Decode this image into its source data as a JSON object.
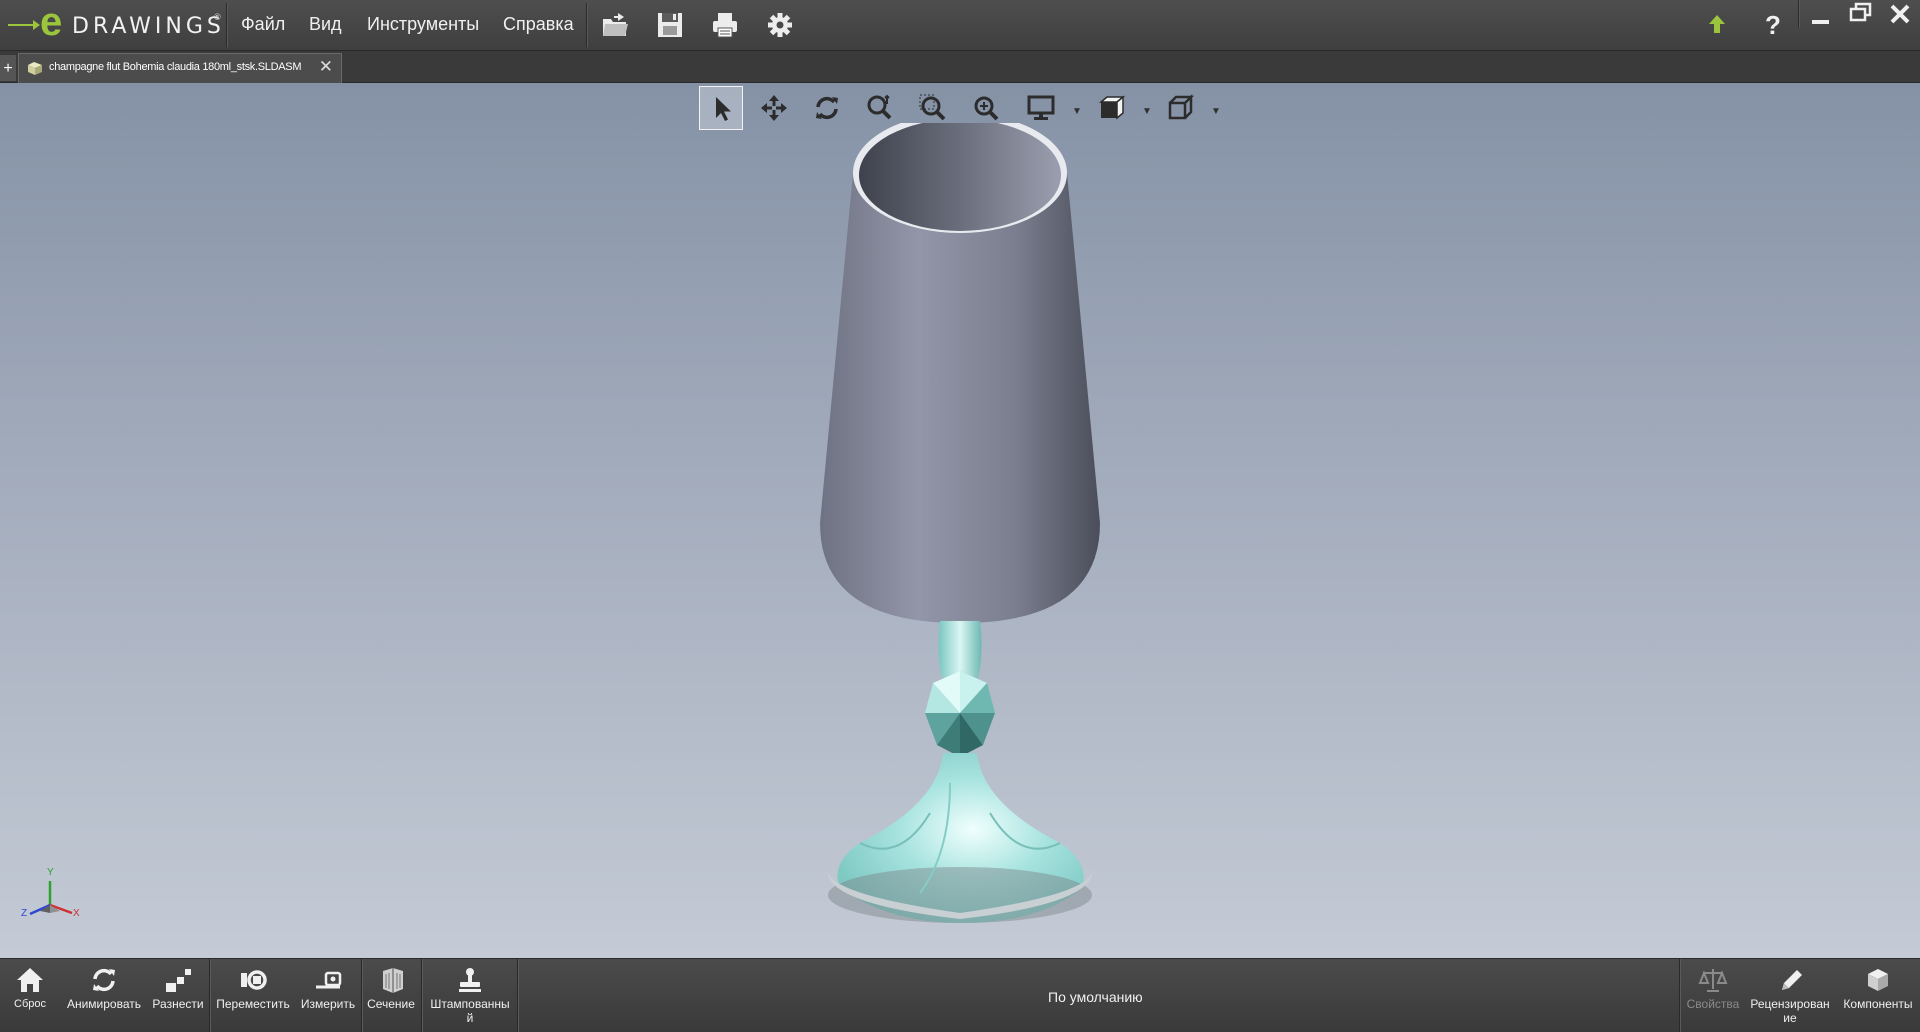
{
  "app": {
    "logo_e": "e",
    "logo_word": "DRAWINGS",
    "logo_mark": "®"
  },
  "menu": {
    "file": "Файл",
    "view": "Вид",
    "tools": "Инструменты",
    "help": "Справка"
  },
  "toolbar_icons": [
    "open-icon",
    "save-icon",
    "print-icon",
    "settings-icon"
  ],
  "window_controls": [
    "update-arrow-icon",
    "help-icon",
    "minimize-icon",
    "restore-icon",
    "close-icon"
  ],
  "help_glyph": "?",
  "tab": {
    "add": "+",
    "title": "champagne flut Bohemia claudia 180ml_stsk.SLDASM",
    "close": "✕"
  },
  "heads_up_toolbar": [
    "select-icon",
    "pan-icon",
    "rotate-icon",
    "zoom-to-fit-icon",
    "zoom-to-area-icon",
    "zoom-icon",
    "display-style-icon",
    "view-orientation-icon",
    "standard-views-icon"
  ],
  "triad": {
    "x": "X",
    "y": "Y",
    "z": "Z"
  },
  "bottom_bar": {
    "reset": "Сброс",
    "animate": "Анимировать",
    "explode": "Разнести",
    "move": "Переместить",
    "measure": "Измерить",
    "section": "Сечение",
    "stamp_1": "Штампованны",
    "stamp_2": "й",
    "configuration": "По умолчанию",
    "properties": "Свойства",
    "review_1": "Рецензирован",
    "review_2": "ие",
    "components": "Компоненты"
  },
  "colors": {
    "accent": "#9bc53d",
    "glass": "#8a8f9e",
    "stem": "#a7e3df",
    "viewport_top": "#8592a6",
    "viewport_bottom": "#c4cbd6"
  }
}
